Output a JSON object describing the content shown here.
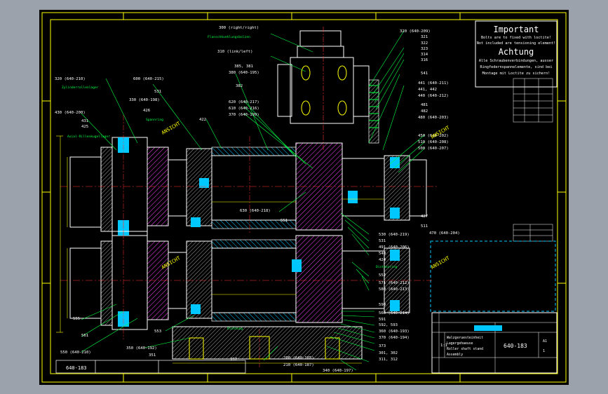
{
  "notice": {
    "important_title": "Important",
    "important_line1": "Bolts are to fixed with loctite!",
    "important_line2": "Not included are tensioning element!",
    "achtung_title": "Achtung",
    "achtung_line1": "Alle Schraubenverbindungen, ausser",
    "achtung_line2": "Ringfedernspannelemente, sind bei",
    "achtung_line3": "Montage mit Loctite zu sichern!"
  },
  "callouts": {
    "l300": "300 (right/right)",
    "l310": "310 (link/left)",
    "l320a": "320 (640-210)",
    "l320b": "320 (640-209)",
    "l321": "321",
    "l322": "322",
    "l323": "323",
    "l314": "314",
    "l316": "316",
    "l600": "600 (640-215)",
    "l531": "531",
    "l330": "330 (640-198)",
    "l426": "426",
    "l430": "430 (640-200)",
    "l431": "431",
    "l425": "425",
    "l422": "422",
    "l385": "385, 381",
    "l380": "380 (640-195)",
    "l382": "382",
    "l620": "620 (640-217)",
    "l610": "610 (640-216)",
    "l370": "370 (640-199)",
    "l541": "541",
    "l441": "441 (640-211)",
    "l442": "441, 442",
    "l440": "440 (640-212)",
    "l481": "481",
    "l482": "482",
    "l480": "480 (640-203)",
    "l450": "450 (640-202)",
    "l510": "510 (640-208)",
    "l500": "500 (640-207)",
    "l630": "630 (640-218)",
    "l551": "551",
    "l427": "427",
    "l511": "511",
    "l470": "470 (640-204)",
    "l530": "530 (640-219)",
    "l531b": "531",
    "l491": "491 (640-206)",
    "l540": "540",
    "l424": "424",
    "l552": "552",
    "l571": "571 (640-212)",
    "l580": "580 (640-213)",
    "l590": "590",
    "l560": "560 (640-214)",
    "l591": "591",
    "l592": "592, 593",
    "l360": "360 (640-193)",
    "l370b": "370 (640-194)",
    "l373": "373",
    "l301": "301, 302",
    "l311": "311, 312",
    "l340": "340 (640-197)",
    "l200": "200 (640-185)",
    "l210": "210 (640-187)",
    "l357": "357",
    "l555": "555",
    "l561": "561",
    "l550": "550 (640-210)",
    "l553": "553",
    "l350": "350 (640-192)",
    "l351": "351"
  },
  "stamps": [
    "ANSICHT",
    "ANSICHT",
    "ANSICHT",
    "ANSICHT"
  ],
  "notes": {
    "note_a": "Flanschkuehlungsbolzen",
    "note_b": "Zylinderrollenlager",
    "note_c": "Axial-Rillenkugellager",
    "note_d": "Spannring",
    "note_e": "Distanzring",
    "note_f": "Dichtung"
  },
  "title_block": {
    "desc_line1": "Walzgeruesteinheit",
    "desc_line2": "Lagergehaeuse",
    "desc_line3": "Roller shaft stand",
    "desc_line4": "Assembly",
    "drawing_no": "640-183",
    "left_no": "640-183",
    "scale": "1:1",
    "sheet": "1",
    "format": "A1"
  },
  "colors": {
    "sheet_bg": "#000000",
    "frame": "#ffff00",
    "text": "#ffffff",
    "dim": "#ffff00",
    "part_cyan": "#00c8ff",
    "hatch_magenta": "#ff40ff",
    "centerline_red": "#ff3030",
    "leader_green": "#00ff44"
  }
}
